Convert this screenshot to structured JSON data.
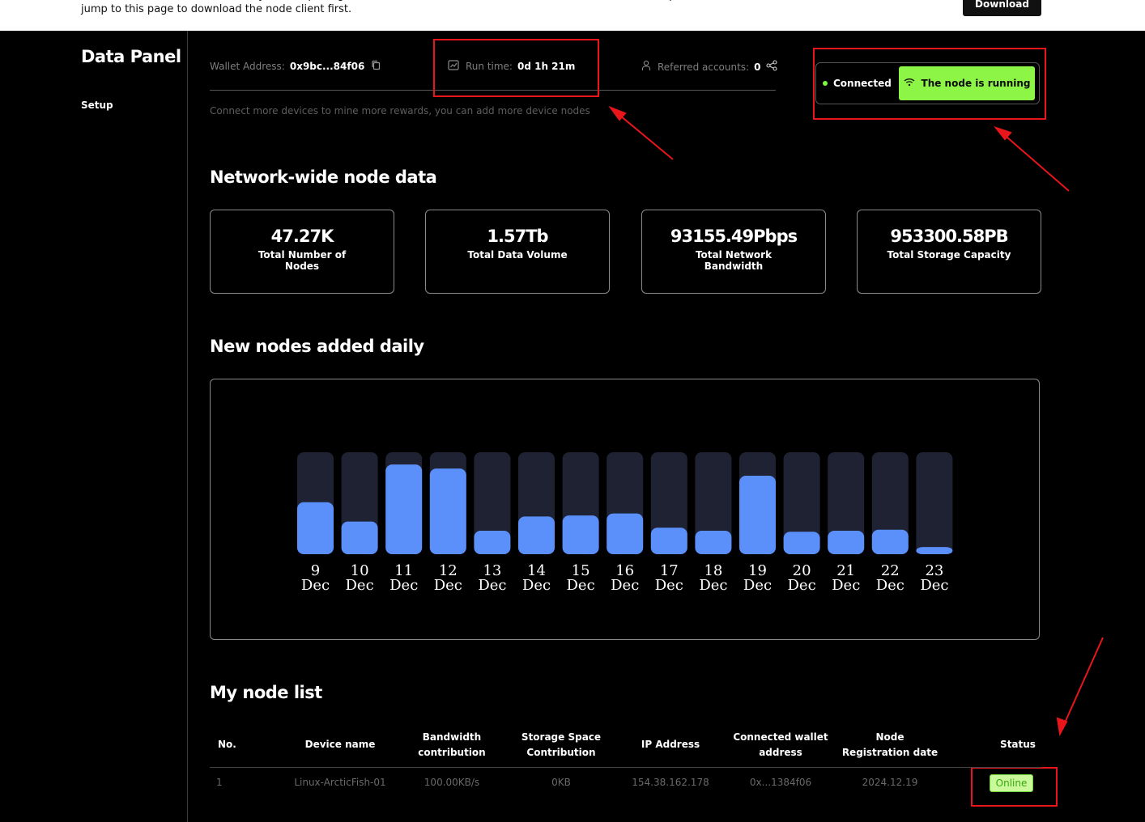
{
  "banner": {
    "message": "The current network detects that you are opening the node client. If the node client has not been downloaded, please click the button to jump to this page to download the node client first.",
    "download_label": "Download"
  },
  "sidebar": {
    "title": "Data Panel",
    "items": [
      {
        "label": "Setup"
      }
    ]
  },
  "info": {
    "wallet_label": "Wallet Address:",
    "wallet_value": "0x9bc...84f06",
    "runtime_label": "Run time:",
    "runtime_value": "0d 1h 21m",
    "referred_label": "Referred accounts:",
    "referred_value": "0",
    "hint": "Connect more devices to mine more rewards, you can add more device nodes"
  },
  "status": {
    "connected_label": "Connected",
    "running_label": "The node is running",
    "accent": "#8cf545"
  },
  "network": {
    "title": "Network-wide node data",
    "cards": [
      {
        "value": "47.27K",
        "label": "Total Number of Nodes"
      },
      {
        "value": "1.57Tb",
        "label": "Total Data Volume"
      },
      {
        "value": "93155.49Pbps",
        "label": "Total Network Bandwidth"
      },
      {
        "value": "953300.58PB",
        "label": "Total Storage Capacity"
      }
    ]
  },
  "daily": {
    "title": "New nodes added daily"
  },
  "chart_data": {
    "type": "bar",
    "categories": [
      "9 Dec",
      "10 Dec",
      "11 Dec",
      "12 Dec",
      "13 Dec",
      "14 Dec",
      "15 Dec",
      "16 Dec",
      "17 Dec",
      "18 Dec",
      "19 Dec",
      "20 Dec",
      "21 Dec",
      "22 Dec",
      "23 Dec"
    ],
    "values": [
      51,
      32,
      88,
      84,
      23,
      37,
      38,
      40,
      26,
      23,
      77,
      22,
      23,
      24,
      7
    ],
    "ylim": [
      0,
      100
    ],
    "bar_color": "#5b8ff9",
    "track_color": "#1e2233",
    "grid": false
  },
  "nodes": {
    "title": "My node list",
    "headers": [
      "No.",
      "Device name",
      "Bandwidth contribution",
      "Storage Space Contribution",
      "IP Address",
      "Connected wallet address",
      "Node Registration date",
      "Status"
    ],
    "rows": [
      {
        "no": "1",
        "device": "Linux-ArcticFish-01",
        "bandwidth": "100.00KB/s",
        "storage": "0KB",
        "ip": "154.38.162.178",
        "wallet": "0x...1384f06",
        "date": "2024.12.19",
        "status": "Online"
      }
    ]
  },
  "annotation_color": "#e8161b"
}
